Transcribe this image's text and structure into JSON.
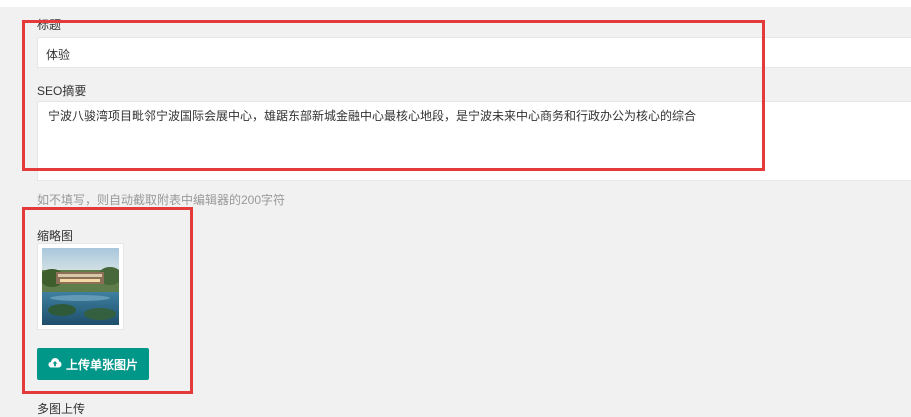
{
  "form": {
    "title_label": "标题",
    "title_value": "体验",
    "seo_label": "SEO摘要",
    "seo_value": "宁波八骏湾项目毗邻宁波国际会展中心，雄踞东部新城金融中心最核心地段，是宁波未来中心商务和行政办公为核心的综合",
    "seo_hint": "如不填写，则自动截取附表中编辑器的200字符",
    "thumbnail_label": "缩略图",
    "upload_single_label": "上传单张图片",
    "multi_upload_label": "多图上传"
  },
  "colors": {
    "accent": "#009688",
    "highlight": "#e43a3a",
    "background": "#f1f1f1"
  },
  "icons": {
    "upload": "cloud-upload-icon"
  }
}
